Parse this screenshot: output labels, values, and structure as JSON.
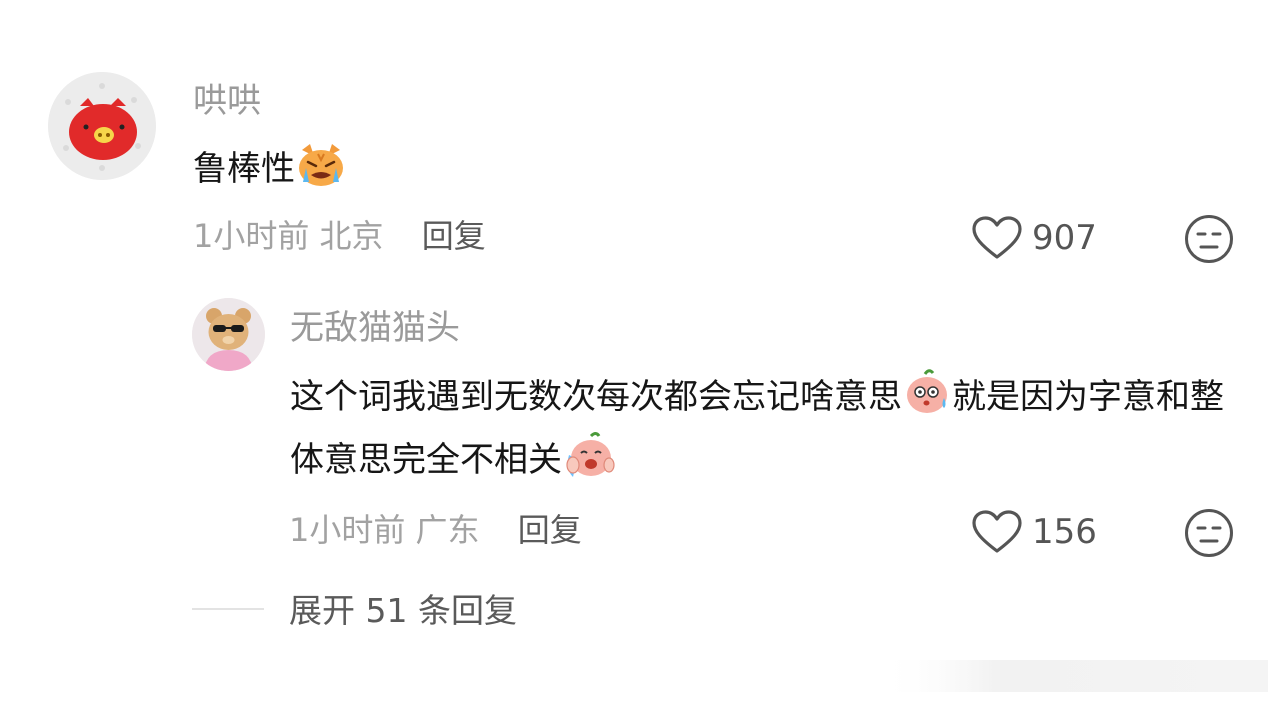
{
  "comment": {
    "username": "哄哄",
    "text": "鲁棒性",
    "time": "1小时前",
    "location": "北京",
    "reply_label": "回复",
    "likes": "907"
  },
  "reply": {
    "username": "无敌猫猫头",
    "text_line1_a": "这个词我遇到无数次每次都会忘记啥意思",
    "text_line1_b": "就是因",
    "text_line2": "为字意和整体意思完全不相关",
    "time": "1小时前",
    "location": "广东",
    "reply_label": "回复",
    "likes": "156"
  },
  "expand": {
    "label": "展开 51 条回复"
  },
  "colors": {
    "username": "#9a9a9a",
    "text": "#161616",
    "meta": "#a2a2a2",
    "action": "#5a5a5a",
    "icon": "#555555"
  },
  "icons": [
    "pig-avatar-icon",
    "bear-avatar-icon",
    "crying-cat-emoji",
    "sweating-peach-emoji",
    "crying-peach-emoji",
    "heart-icon",
    "meh-face-icon"
  ]
}
